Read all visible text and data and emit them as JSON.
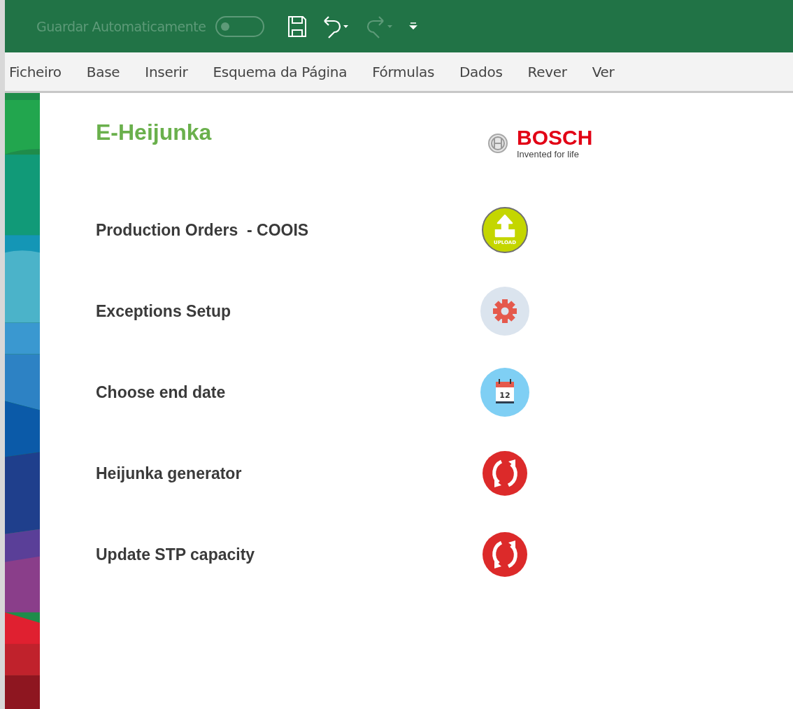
{
  "title_bar": {
    "autosave_label": "Guardar Automaticamente",
    "autosave_on": false
  },
  "ribbon_tabs": [
    {
      "label": "Ficheiro"
    },
    {
      "label": "Base"
    },
    {
      "label": "Inserir"
    },
    {
      "label": "Esquema da Página"
    },
    {
      "label": "Fórmulas"
    },
    {
      "label": "Dados"
    },
    {
      "label": "Rever"
    },
    {
      "label": "Ver"
    }
  ],
  "sheet": {
    "title": "E-Heijunka",
    "logo": {
      "brand": "BOSCH",
      "tagline": "Invented for life"
    },
    "actions": [
      {
        "label": "Production Orders  - COOIS",
        "kind": "upload",
        "icon_text": "UPLOAD"
      },
      {
        "label": "Exceptions Setup",
        "kind": "gear"
      },
      {
        "label": "Choose end date",
        "kind": "calendar",
        "icon_text": "12"
      },
      {
        "label": "Heijunka generator",
        "kind": "refresh"
      },
      {
        "label": "Update STP capacity",
        "kind": "refresh"
      }
    ]
  }
}
